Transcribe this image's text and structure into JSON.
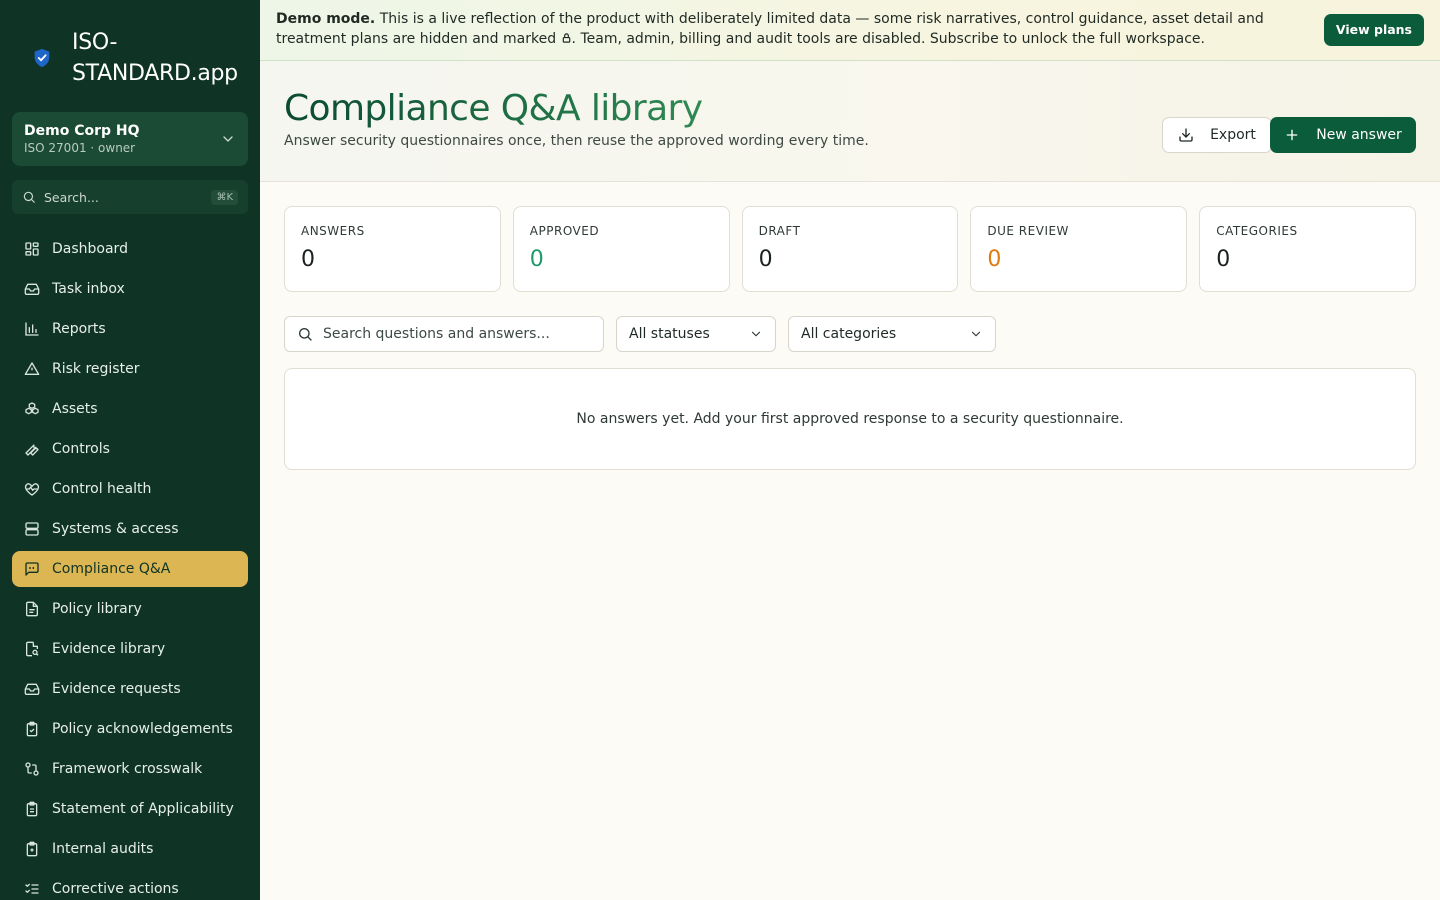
{
  "app": {
    "name": "ISO-STANDARD.app",
    "name_line1": "ISO-",
    "name_line2": "STANDARD.app"
  },
  "org": {
    "name": "Demo Corp HQ",
    "subtitle": "ISO 27001 · owner"
  },
  "sidebar_search": {
    "placeholder": "Search...",
    "shortcut": "⌘K"
  },
  "sidebar": {
    "items": [
      {
        "label": "Dashboard",
        "icon": "dashboard-icon"
      },
      {
        "label": "Task inbox",
        "icon": "inbox-icon"
      },
      {
        "label": "Reports",
        "icon": "bar-chart-icon"
      },
      {
        "label": "Risk register",
        "icon": "warning-triangle-icon"
      },
      {
        "label": "Assets",
        "icon": "boxes-icon"
      },
      {
        "label": "Controls",
        "icon": "wrench-icon"
      },
      {
        "label": "Control health",
        "icon": "heart-pulse-icon"
      },
      {
        "label": "Systems & access",
        "icon": "server-icon"
      },
      {
        "label": "Compliance Q&A",
        "icon": "message-square-icon",
        "active": true
      },
      {
        "label": "Policy library",
        "icon": "file-text-icon"
      },
      {
        "label": "Evidence library",
        "icon": "file-search-icon"
      },
      {
        "label": "Evidence requests",
        "icon": "inbox-icon"
      },
      {
        "label": "Policy acknowledgements",
        "icon": "clipboard-check-icon"
      },
      {
        "label": "Framework crosswalk",
        "icon": "git-compare-icon"
      },
      {
        "label": "Statement of Applicability",
        "icon": "clipboard-list-icon"
      },
      {
        "label": "Internal audits",
        "icon": "clipboard-icon"
      },
      {
        "label": "Corrective actions",
        "icon": "list-checks-icon"
      }
    ]
  },
  "banner": {
    "lead": "Demo mode.",
    "text_before_lock": " This is a live reflection of the product with deliberately limited data — some risk narratives, control guidance, asset detail and treatment plans are hidden and marked ",
    "text_after_lock": ". Team, admin, billing and audit tools are disabled. Subscribe to unlock the full workspace.",
    "button": "View plans"
  },
  "header": {
    "title": "Compliance Q&A library",
    "subtitle": "Answer security questionnaires once, then reuse the approved wording every time.",
    "export_label": "Export",
    "new_label": "New answer"
  },
  "stats": [
    {
      "label": "ANSWERS",
      "value": "0"
    },
    {
      "label": "APPROVED",
      "value": "0",
      "color": "#1f9a6c"
    },
    {
      "label": "DRAFT",
      "value": "0"
    },
    {
      "label": "DUE REVIEW",
      "value": "0",
      "color": "#e07b12"
    },
    {
      "label": "CATEGORIES",
      "value": "0"
    }
  ],
  "filters": {
    "search_placeholder": "Search questions and answers...",
    "search_value": "",
    "status_selected": "All statuses",
    "category_selected": "All categories"
  },
  "empty_state": {
    "message": "No answers yet. Add your first approved response to a security questionnaire."
  },
  "colors": {
    "sidebar_bg": "#0f3325",
    "active_nav": "#dcb652",
    "primary": "#0b5c3a",
    "approved": "#1f9a6c",
    "due_review": "#e07b12"
  }
}
